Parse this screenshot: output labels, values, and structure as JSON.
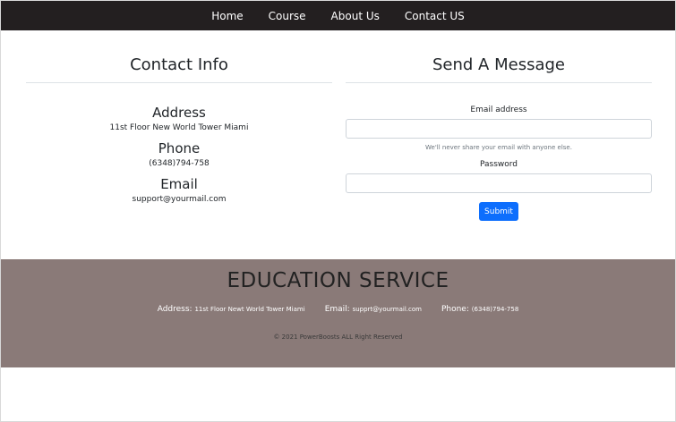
{
  "nav": {
    "items": [
      {
        "label": "Home"
      },
      {
        "label": "Course"
      },
      {
        "label": "About Us"
      },
      {
        "label": "Contact US"
      }
    ]
  },
  "contact_info": {
    "title": "Contact Info",
    "address": {
      "label": "Address",
      "value": "11st Floor New World Tower Miami"
    },
    "phone": {
      "label": "Phone",
      "value": "(6348)794-758"
    },
    "email": {
      "label": "Email",
      "value": "support@yourmail.com"
    }
  },
  "message_form": {
    "title": "Send A Message",
    "email_label": "Email address",
    "email_value": "",
    "email_help": "We'll never share your email with anyone else.",
    "password_label": "Password",
    "password_value": "",
    "submit_label": "Submit"
  },
  "footer": {
    "title": "EDUCATION SERVICE",
    "address_label": "Address:",
    "address_value": "11st Floor Newt World Tower Miami",
    "email_label": "Email:",
    "email_value": "supprt@yourmail.com",
    "phone_label": "Phone:",
    "phone_value": "(6348)794-758",
    "copyright": "© 2021 PowerBoosts ALL Right Reserved"
  },
  "colors": {
    "navbar_bg": "#231f20",
    "footer_bg": "#8a7a78",
    "button_primary": "#0d6efd"
  }
}
